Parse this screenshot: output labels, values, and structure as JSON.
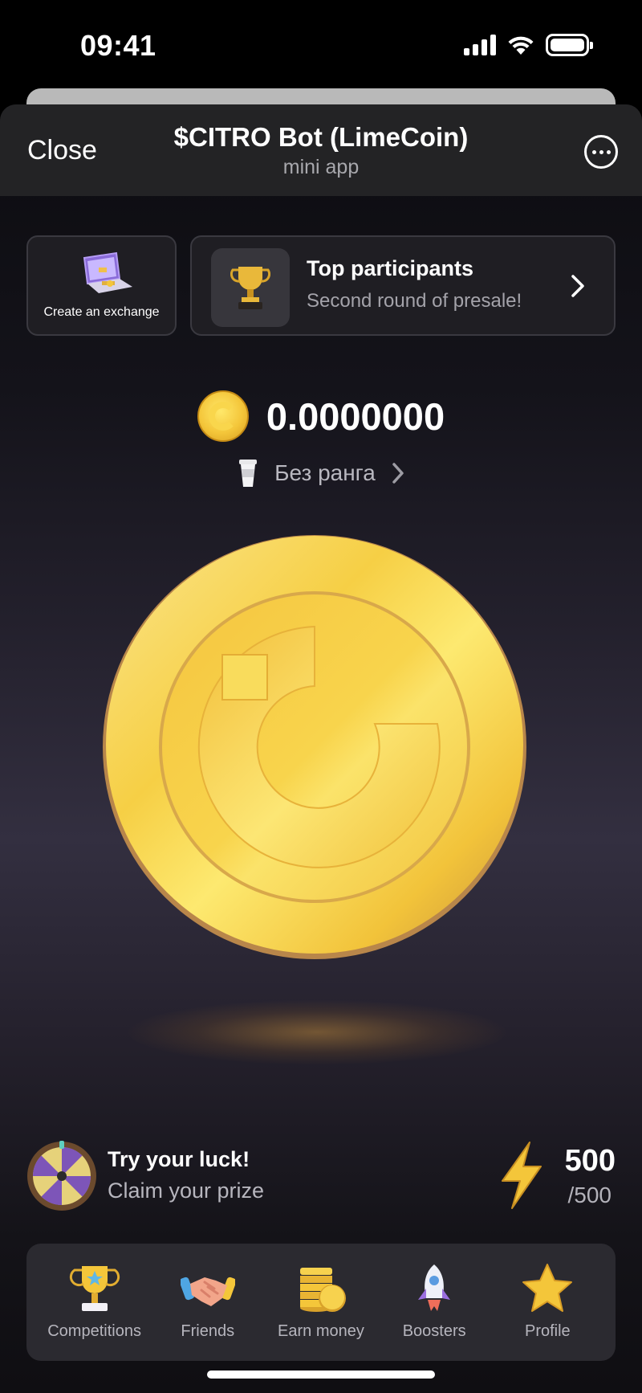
{
  "status_bar": {
    "time": "09:41"
  },
  "header": {
    "close_label": "Close",
    "title": "$CITRO Bot (LimeCoin)",
    "subtitle": "mini app"
  },
  "cards": {
    "exchange": {
      "label": "Create an exchange",
      "icon": "laptop-icon"
    },
    "top_participants": {
      "title": "Top participants",
      "subtitle": "Second round of presale!",
      "icon": "trophy-icon"
    }
  },
  "balance": {
    "value": "0.0000000",
    "rank": "Без ранга"
  },
  "luck": {
    "title": "Try your luck!",
    "subtitle": "Claim your prize"
  },
  "energy": {
    "current": "500",
    "max": "/500"
  },
  "nav": {
    "items": [
      {
        "label": "Competitions",
        "icon": "trophy-icon"
      },
      {
        "label": "Friends",
        "icon": "handshake-icon"
      },
      {
        "label": "Earn money",
        "icon": "coins-icon"
      },
      {
        "label": "Boosters",
        "icon": "rocket-icon"
      },
      {
        "label": "Profile",
        "icon": "star-icon"
      }
    ]
  },
  "colors": {
    "gold": "#f4c63a",
    "background": "#14131a",
    "card": "#1f1e23"
  }
}
